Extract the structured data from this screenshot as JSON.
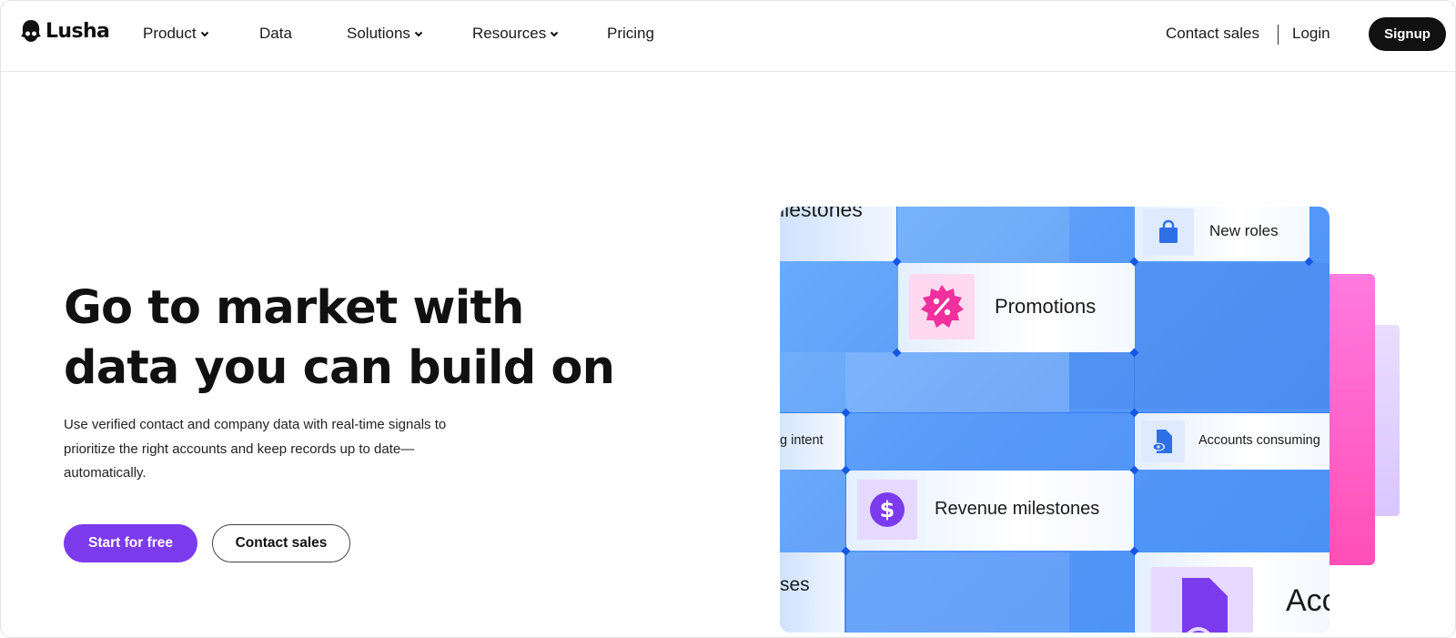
{
  "header": {
    "brand": "Lusha",
    "nav": [
      {
        "label": "Product",
        "has_dropdown": true
      },
      {
        "label": "Data",
        "has_dropdown": false
      },
      {
        "label": "Solutions",
        "has_dropdown": true
      },
      {
        "label": "Resources",
        "has_dropdown": true
      },
      {
        "label": "Pricing",
        "has_dropdown": false
      }
    ],
    "contact_sales": "Contact sales",
    "login": "Login",
    "signup": "Signup"
  },
  "hero": {
    "title_line1": "Go to market with",
    "title_line2": "data you can build on",
    "description": "Use verified contact and company data with real-time signals to prioritize the right accounts and keep records up to date—automatically.",
    "cta_primary": "Start for free",
    "cta_secondary": "Contact sales"
  },
  "illustration": {
    "cards": {
      "milestones_partial": "ilestones",
      "new_roles": "New roles",
      "promotions": "Promotions",
      "intent_partial": "g intent",
      "accounts_consuming": "Accounts consuming",
      "revenue_milestones": "Revenue milestones",
      "ses_partial": "ses",
      "acc_partial": "Acc"
    },
    "icons": {
      "new_roles": "shopping-bag-icon",
      "promotions": "percent-badge-icon",
      "accounts_consuming": "document-eye-icon",
      "revenue_milestones": "dollar-circle-icon",
      "acc": "document-icon"
    }
  },
  "colors": {
    "accent": "#7c3aed",
    "grid_blue": "#5699f8",
    "pink": "#ff4fb6",
    "signup_bg": "#111111"
  }
}
